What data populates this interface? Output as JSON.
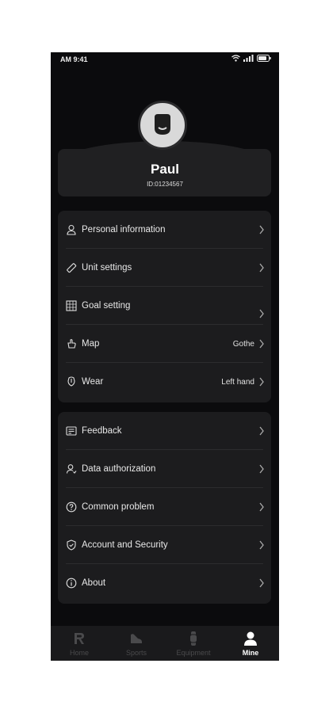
{
  "status_bar": {
    "time": "AM  9:41"
  },
  "profile": {
    "name": "Paul",
    "id": "ID:01234567"
  },
  "menu_group_1": [
    {
      "label": "Personal information",
      "value": "",
      "icon": "person-icon"
    },
    {
      "label": "Unit settings",
      "value": "",
      "icon": "ruler-icon"
    },
    {
      "label": "Goal setting",
      "value": "",
      "icon": "target-icon"
    },
    {
      "label": "Map",
      "value": "Gothe",
      "icon": "map-icon"
    },
    {
      "label": "Wear",
      "value": "Left hand",
      "icon": "watch-icon"
    }
  ],
  "menu_group_2": [
    {
      "label": "Feedback",
      "value": "",
      "icon": "feedback-icon"
    },
    {
      "label": "Data authorization",
      "value": "",
      "icon": "user-auth-icon"
    },
    {
      "label": "Common problem",
      "value": "",
      "icon": "question-icon"
    },
    {
      "label": "Account and Security",
      "value": "",
      "icon": "shield-icon"
    },
    {
      "label": "About",
      "value": "",
      "icon": "info-icon"
    }
  ],
  "tabs": [
    {
      "label": "Home",
      "icon": "home-logo-icon",
      "active": false
    },
    {
      "label": "Sports",
      "icon": "shoe-icon",
      "active": false
    },
    {
      "label": "Equipment",
      "icon": "watch-device-icon",
      "active": false
    },
    {
      "label": "Mine",
      "icon": "user-icon",
      "active": true
    }
  ],
  "colors": {
    "background": "#0b0b0d",
    "card": "#1c1c1e",
    "active_tab": "#ffffff",
    "inactive_tab": "#4a4a4c"
  }
}
